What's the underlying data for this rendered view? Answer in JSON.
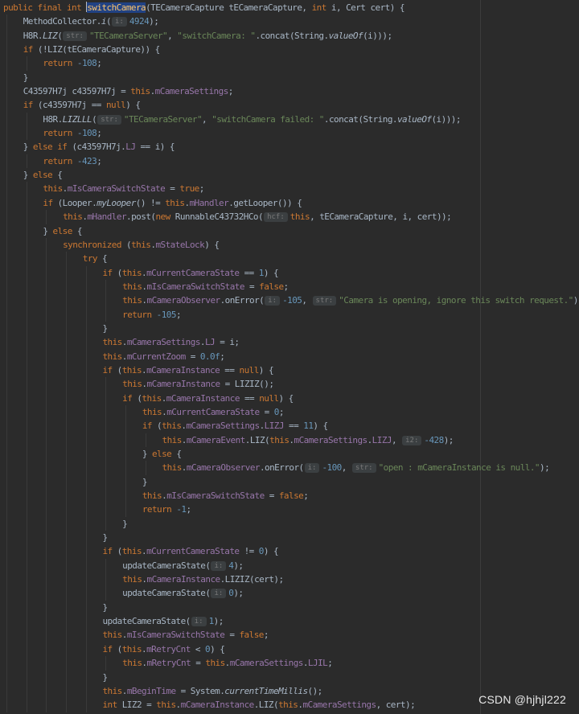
{
  "watermark": "CSDN @hjhjl222",
  "syntax_colors": {
    "keyword": "#cc7832",
    "field": "#9876aa",
    "string": "#6a8759",
    "number": "#6897bb",
    "method_declaration": "#ffc66d",
    "default_text": "#a9b7c6",
    "background": "#2b2b2b",
    "hint_background": "#3b3f41"
  },
  "lines": [
    {
      "indent": 0,
      "tokens": [
        [
          "kw",
          "public final int "
        ],
        [
          "caret",
          ""
        ],
        [
          "decl",
          "switchCamera"
        ],
        [
          "p",
          "(TECameraCapture tECameraCapture, "
        ],
        [
          "kw",
          "int "
        ],
        [
          "p",
          "i, Cert cert) {"
        ]
      ]
    },
    {
      "indent": 1,
      "tokens": [
        [
          "p",
          "MethodCollector."
        ],
        [
          "it",
          "i"
        ],
        [
          "p",
          "("
        ],
        [
          "hint",
          "i:"
        ],
        [
          "num",
          "4924"
        ],
        [
          "p",
          ");"
        ]
      ]
    },
    {
      "indent": 1,
      "tokens": [
        [
          "p",
          "H8R."
        ],
        [
          "it",
          "LIZ"
        ],
        [
          "p",
          "("
        ],
        [
          "hint",
          "str:"
        ],
        [
          "str",
          "\"TECameraServer\""
        ],
        [
          "p",
          ", "
        ],
        [
          "str",
          "\"switchCamera: \""
        ],
        [
          "p",
          ".concat(String."
        ],
        [
          "it",
          "valueOf"
        ],
        [
          "p",
          "(i)));"
        ]
      ]
    },
    {
      "indent": 1,
      "tokens": [
        [
          "kw",
          "if "
        ],
        [
          "p",
          "(!LIZ(tECameraCapture)) {"
        ]
      ]
    },
    {
      "indent": 2,
      "tokens": [
        [
          "kw",
          "return "
        ],
        [
          "num",
          "-108"
        ],
        [
          "p",
          ";"
        ]
      ]
    },
    {
      "indent": 1,
      "tokens": [
        [
          "p",
          "}"
        ]
      ]
    },
    {
      "indent": 1,
      "tokens": [
        [
          "p",
          "C43597H7j c43597H7j = "
        ],
        [
          "kw",
          "this"
        ],
        [
          "p",
          "."
        ],
        [
          "fld",
          "mCameraSettings"
        ],
        [
          "p",
          ";"
        ]
      ]
    },
    {
      "indent": 1,
      "tokens": [
        [
          "kw",
          "if "
        ],
        [
          "p",
          "(c43597H7j == "
        ],
        [
          "kw",
          "null"
        ],
        [
          "p",
          ") {"
        ]
      ]
    },
    {
      "indent": 2,
      "tokens": [
        [
          "p",
          "H8R."
        ],
        [
          "it",
          "LIZLLL"
        ],
        [
          "p",
          "("
        ],
        [
          "hint",
          "str:"
        ],
        [
          "str",
          "\"TECameraServer\""
        ],
        [
          "p",
          ", "
        ],
        [
          "str",
          "\"switchCamera failed: \""
        ],
        [
          "p",
          ".concat(String."
        ],
        [
          "it",
          "valueOf"
        ],
        [
          "p",
          "(i)));"
        ]
      ]
    },
    {
      "indent": 2,
      "tokens": [
        [
          "kw",
          "return "
        ],
        [
          "num",
          "-108"
        ],
        [
          "p",
          ";"
        ]
      ]
    },
    {
      "indent": 1,
      "tokens": [
        [
          "p",
          "} "
        ],
        [
          "kw",
          "else if "
        ],
        [
          "p",
          "(c43597H7j."
        ],
        [
          "fld",
          "LJ"
        ],
        [
          "p",
          " == i) {"
        ]
      ]
    },
    {
      "indent": 2,
      "tokens": [
        [
          "kw",
          "return "
        ],
        [
          "num",
          "-423"
        ],
        [
          "p",
          ";"
        ]
      ]
    },
    {
      "indent": 1,
      "tokens": [
        [
          "p",
          "} "
        ],
        [
          "kw",
          "else "
        ],
        [
          "p",
          "{"
        ]
      ]
    },
    {
      "indent": 2,
      "tokens": [
        [
          "kw",
          "this"
        ],
        [
          "p",
          "."
        ],
        [
          "fld",
          "mIsCameraSwitchState"
        ],
        [
          "p",
          " = "
        ],
        [
          "kw",
          "true"
        ],
        [
          "p",
          ";"
        ]
      ]
    },
    {
      "indent": 2,
      "tokens": [
        [
          "kw",
          "if "
        ],
        [
          "p",
          "(Looper."
        ],
        [
          "it",
          "myLooper"
        ],
        [
          "p",
          "() != "
        ],
        [
          "kw",
          "this"
        ],
        [
          "p",
          "."
        ],
        [
          "fld",
          "mHandler"
        ],
        [
          "p",
          ".getLooper()) {"
        ]
      ]
    },
    {
      "indent": 3,
      "tokens": [
        [
          "kw",
          "this"
        ],
        [
          "p",
          "."
        ],
        [
          "fld",
          "mHandler"
        ],
        [
          "p",
          ".post("
        ],
        [
          "kw",
          "new "
        ],
        [
          "p",
          "RunnableC43732HCo("
        ],
        [
          "hint",
          "hcf:"
        ],
        [
          "kw",
          "this"
        ],
        [
          "p",
          ", tECameraCapture, i, cert));"
        ]
      ]
    },
    {
      "indent": 2,
      "tokens": [
        [
          "p",
          "} "
        ],
        [
          "kw",
          "else "
        ],
        [
          "p",
          "{"
        ]
      ]
    },
    {
      "indent": 3,
      "tokens": [
        [
          "kw",
          "synchronized "
        ],
        [
          "p",
          "("
        ],
        [
          "kw",
          "this"
        ],
        [
          "p",
          "."
        ],
        [
          "fld",
          "mStateLock"
        ],
        [
          "p",
          ") {"
        ]
      ]
    },
    {
      "indent": 4,
      "tokens": [
        [
          "kw",
          "try "
        ],
        [
          "p",
          "{"
        ]
      ]
    },
    {
      "indent": 5,
      "tokens": [
        [
          "kw",
          "if "
        ],
        [
          "p",
          "("
        ],
        [
          "kw",
          "this"
        ],
        [
          "p",
          "."
        ],
        [
          "fld",
          "mCurrentCameraState"
        ],
        [
          "p",
          " == "
        ],
        [
          "num",
          "1"
        ],
        [
          "p",
          ") {"
        ]
      ]
    },
    {
      "indent": 6,
      "tokens": [
        [
          "kw",
          "this"
        ],
        [
          "p",
          "."
        ],
        [
          "fld",
          "mIsCameraSwitchState"
        ],
        [
          "p",
          " = "
        ],
        [
          "kw",
          "false"
        ],
        [
          "p",
          ";"
        ]
      ]
    },
    {
      "indent": 6,
      "tokens": [
        [
          "kw",
          "this"
        ],
        [
          "p",
          "."
        ],
        [
          "fld",
          "mCameraObserver"
        ],
        [
          "p",
          ".onError("
        ],
        [
          "hint",
          "i:"
        ],
        [
          "num",
          "-105"
        ],
        [
          "p",
          ", "
        ],
        [
          "hint",
          "str:"
        ],
        [
          "str",
          "\"Camera is opening, ignore this switch request.\""
        ],
        [
          "p",
          ");"
        ]
      ]
    },
    {
      "indent": 6,
      "tokens": [
        [
          "kw",
          "return "
        ],
        [
          "num",
          "-105"
        ],
        [
          "p",
          ";"
        ]
      ]
    },
    {
      "indent": 5,
      "tokens": [
        [
          "p",
          "}"
        ]
      ]
    },
    {
      "indent": 5,
      "tokens": [
        [
          "kw",
          "this"
        ],
        [
          "p",
          "."
        ],
        [
          "fld",
          "mCameraSettings"
        ],
        [
          "p",
          "."
        ],
        [
          "fld",
          "LJ"
        ],
        [
          "p",
          " = i;"
        ]
      ]
    },
    {
      "indent": 5,
      "tokens": [
        [
          "kw",
          "this"
        ],
        [
          "p",
          "."
        ],
        [
          "fld",
          "mCurrentZoom"
        ],
        [
          "p",
          " = "
        ],
        [
          "num",
          "0.0f"
        ],
        [
          "p",
          ";"
        ]
      ]
    },
    {
      "indent": 5,
      "tokens": [
        [
          "kw",
          "if "
        ],
        [
          "p",
          "("
        ],
        [
          "kw",
          "this"
        ],
        [
          "p",
          "."
        ],
        [
          "fld",
          "mCameraInstance"
        ],
        [
          "p",
          " == "
        ],
        [
          "kw",
          "null"
        ],
        [
          "p",
          ") {"
        ]
      ]
    },
    {
      "indent": 6,
      "tokens": [
        [
          "kw",
          "this"
        ],
        [
          "p",
          "."
        ],
        [
          "fld",
          "mCameraInstance"
        ],
        [
          "p",
          " = LIZIZ();"
        ]
      ]
    },
    {
      "indent": 6,
      "tokens": [
        [
          "kw",
          "if "
        ],
        [
          "p",
          "("
        ],
        [
          "kw",
          "this"
        ],
        [
          "p",
          "."
        ],
        [
          "fld",
          "mCameraInstance"
        ],
        [
          "p",
          " == "
        ],
        [
          "kw",
          "null"
        ],
        [
          "p",
          ") {"
        ]
      ]
    },
    {
      "indent": 7,
      "tokens": [
        [
          "kw",
          "this"
        ],
        [
          "p",
          "."
        ],
        [
          "fld",
          "mCurrentCameraState"
        ],
        [
          "p",
          " = "
        ],
        [
          "num",
          "0"
        ],
        [
          "p",
          ";"
        ]
      ]
    },
    {
      "indent": 7,
      "tokens": [
        [
          "kw",
          "if "
        ],
        [
          "p",
          "("
        ],
        [
          "kw",
          "this"
        ],
        [
          "p",
          "."
        ],
        [
          "fld",
          "mCameraSettings"
        ],
        [
          "p",
          "."
        ],
        [
          "fld",
          "LIZJ"
        ],
        [
          "p",
          " == "
        ],
        [
          "num",
          "11"
        ],
        [
          "p",
          ") {"
        ]
      ]
    },
    {
      "indent": 8,
      "tokens": [
        [
          "kw",
          "this"
        ],
        [
          "p",
          "."
        ],
        [
          "fld",
          "mCameraEvent"
        ],
        [
          "p",
          ".LIZ("
        ],
        [
          "kw",
          "this"
        ],
        [
          "p",
          "."
        ],
        [
          "fld",
          "mCameraSettings"
        ],
        [
          "p",
          "."
        ],
        [
          "fld",
          "LIZJ"
        ],
        [
          "p",
          ", "
        ],
        [
          "hint",
          "i2:"
        ],
        [
          "num",
          "-428"
        ],
        [
          "p",
          ");"
        ]
      ]
    },
    {
      "indent": 7,
      "tokens": [
        [
          "p",
          "} "
        ],
        [
          "kw",
          "else "
        ],
        [
          "p",
          "{"
        ]
      ]
    },
    {
      "indent": 8,
      "tokens": [
        [
          "kw",
          "this"
        ],
        [
          "p",
          "."
        ],
        [
          "fld",
          "mCameraObserver"
        ],
        [
          "p",
          ".onError("
        ],
        [
          "hint",
          "i:"
        ],
        [
          "num",
          "-100"
        ],
        [
          "p",
          ", "
        ],
        [
          "hint",
          "str:"
        ],
        [
          "str",
          "\"open : mCameraInstance is null.\""
        ],
        [
          "p",
          ");"
        ]
      ]
    },
    {
      "indent": 7,
      "tokens": [
        [
          "p",
          "}"
        ]
      ]
    },
    {
      "indent": 7,
      "tokens": [
        [
          "kw",
          "this"
        ],
        [
          "p",
          "."
        ],
        [
          "fld",
          "mIsCameraSwitchState"
        ],
        [
          "p",
          " = "
        ],
        [
          "kw",
          "false"
        ],
        [
          "p",
          ";"
        ]
      ]
    },
    {
      "indent": 7,
      "tokens": [
        [
          "kw",
          "return "
        ],
        [
          "num",
          "-1"
        ],
        [
          "p",
          ";"
        ]
      ]
    },
    {
      "indent": 6,
      "tokens": [
        [
          "p",
          "}"
        ]
      ]
    },
    {
      "indent": 5,
      "tokens": [
        [
          "p",
          "}"
        ]
      ]
    },
    {
      "indent": 5,
      "tokens": [
        [
          "kw",
          "if "
        ],
        [
          "p",
          "("
        ],
        [
          "kw",
          "this"
        ],
        [
          "p",
          "."
        ],
        [
          "fld",
          "mCurrentCameraState"
        ],
        [
          "p",
          " != "
        ],
        [
          "num",
          "0"
        ],
        [
          "p",
          ") {"
        ]
      ]
    },
    {
      "indent": 6,
      "tokens": [
        [
          "p",
          "updateCameraState("
        ],
        [
          "hint",
          "i:"
        ],
        [
          "num",
          "4"
        ],
        [
          "p",
          ");"
        ]
      ]
    },
    {
      "indent": 6,
      "tokens": [
        [
          "kw",
          "this"
        ],
        [
          "p",
          "."
        ],
        [
          "fld",
          "mCameraInstance"
        ],
        [
          "p",
          ".LIZIZ(cert);"
        ]
      ]
    },
    {
      "indent": 6,
      "tokens": [
        [
          "p",
          "updateCameraState("
        ],
        [
          "hint",
          "i:"
        ],
        [
          "num",
          "0"
        ],
        [
          "p",
          ");"
        ]
      ]
    },
    {
      "indent": 5,
      "tokens": [
        [
          "p",
          "}"
        ]
      ]
    },
    {
      "indent": 5,
      "tokens": [
        [
          "p",
          "updateCameraState("
        ],
        [
          "hint",
          "i:"
        ],
        [
          "num",
          "1"
        ],
        [
          "p",
          ");"
        ]
      ]
    },
    {
      "indent": 5,
      "tokens": [
        [
          "kw",
          "this"
        ],
        [
          "p",
          "."
        ],
        [
          "fld",
          "mIsCameraSwitchState"
        ],
        [
          "p",
          " = "
        ],
        [
          "kw",
          "false"
        ],
        [
          "p",
          ";"
        ]
      ]
    },
    {
      "indent": 5,
      "tokens": [
        [
          "kw",
          "if "
        ],
        [
          "p",
          "("
        ],
        [
          "kw",
          "this"
        ],
        [
          "p",
          "."
        ],
        [
          "fld",
          "mRetryCnt"
        ],
        [
          "p",
          " < "
        ],
        [
          "num",
          "0"
        ],
        [
          "p",
          ") {"
        ]
      ]
    },
    {
      "indent": 6,
      "tokens": [
        [
          "kw",
          "this"
        ],
        [
          "p",
          "."
        ],
        [
          "fld",
          "mRetryCnt"
        ],
        [
          "p",
          " = "
        ],
        [
          "kw",
          "this"
        ],
        [
          "p",
          "."
        ],
        [
          "fld",
          "mCameraSettings"
        ],
        [
          "p",
          "."
        ],
        [
          "fld",
          "LJIL"
        ],
        [
          "p",
          ";"
        ]
      ]
    },
    {
      "indent": 5,
      "tokens": [
        [
          "p",
          "}"
        ]
      ]
    },
    {
      "indent": 5,
      "tokens": [
        [
          "kw",
          "this"
        ],
        [
          "p",
          "."
        ],
        [
          "fld",
          "mBeginTime"
        ],
        [
          "p",
          " = System."
        ],
        [
          "it",
          "currentTimeMillis"
        ],
        [
          "p",
          "();"
        ]
      ]
    },
    {
      "indent": 5,
      "tokens": [
        [
          "kw",
          "int "
        ],
        [
          "p",
          "LIZ2 = "
        ],
        [
          "kw",
          "this"
        ],
        [
          "p",
          "."
        ],
        [
          "fld",
          "mCameraInstance"
        ],
        [
          "p",
          ".LIZ("
        ],
        [
          "kw",
          "this"
        ],
        [
          "p",
          "."
        ],
        [
          "fld",
          "mCameraSettings"
        ],
        [
          "p",
          ", cert);"
        ]
      ]
    }
  ]
}
